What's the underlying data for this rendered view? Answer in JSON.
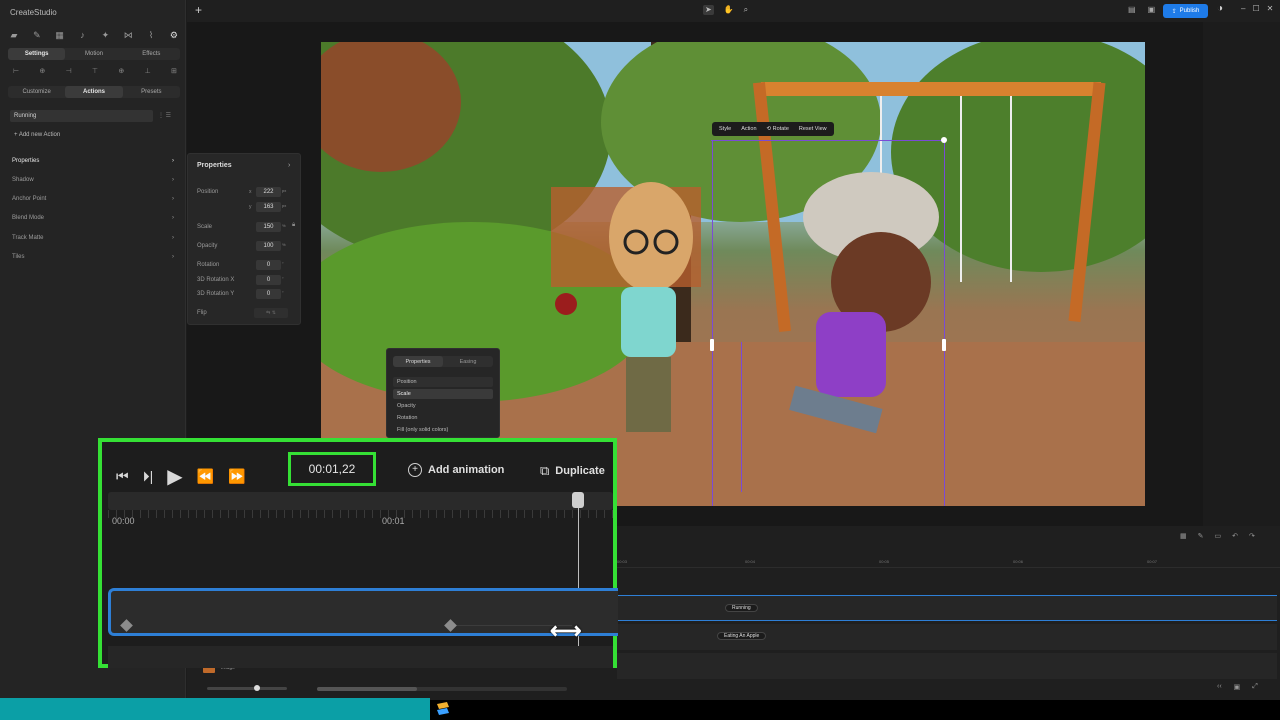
{
  "app": {
    "name": "CreateStudio",
    "brand_color": "#1e7be8",
    "highlight_color": "#35e035"
  },
  "left_panel": {
    "top_icons": [
      "folder-icon",
      "pen-icon",
      "film-icon",
      "audio-icon",
      "magic-icon",
      "transition-icon",
      "brush-icon",
      "gear-icon"
    ],
    "main_tabs": [
      "Settings",
      "Motion",
      "Effects"
    ],
    "main_tab_selected": "Settings",
    "sub_tabs": [
      "Customize",
      "Actions",
      "Presets"
    ],
    "sub_tab_selected": "Actions",
    "action_select_value": "Running",
    "add_action_label": "+ Add new Action",
    "property_list": [
      "Properties",
      "Shadow",
      "Anchor Point",
      "Blend Mode",
      "Track Matte",
      "Tiles"
    ]
  },
  "properties_popover": {
    "title": "Properties",
    "position_label": "Position",
    "x_label": "x",
    "x_value": "222",
    "x_unit": "px",
    "y_label": "y",
    "y_value": "163",
    "y_unit": "px",
    "scale_label": "Scale",
    "scale_value": "150",
    "scale_unit": "%",
    "opacity_label": "Opacity",
    "opacity_value": "100",
    "opacity_unit": "%",
    "rotation_label": "Rotation",
    "rotation_value": "0",
    "rotation_unit": "°",
    "rot3dx_label": "3D Rotation X",
    "rot3dx_value": "0",
    "rot3dx_unit": "°",
    "rot3dy_label": "3D Rotation Y",
    "rot3dy_value": "0",
    "rot3dy_unit": "°",
    "flip_label": "Flip"
  },
  "topbar": {
    "publish_label": "Publish"
  },
  "canvas_toolbar": {
    "items": [
      "Style",
      "Action",
      "Rotate",
      "Reset View"
    ]
  },
  "easing_popover": {
    "tabs": [
      "Properties",
      "Easing"
    ],
    "tab_selected": "Properties",
    "items": [
      "Position",
      "Scale",
      "Opacity",
      "Rotation",
      "Fill (only solid colors)"
    ],
    "selected_item": "Scale"
  },
  "timeline": {
    "ruler_labels": [
      "00:03",
      "00:04",
      "00:05",
      "00:06",
      "00:07"
    ],
    "tracks": [
      {
        "label": "Running"
      },
      {
        "label": "Eating An Apple"
      }
    ],
    "footer_track_label": "Image"
  },
  "zoom_overlay": {
    "time": "00:01,22",
    "add_animation_label": "Add animation",
    "duplicate_label": "Duplicate",
    "ruler_start": "00:00",
    "ruler_mid": "00:01"
  }
}
